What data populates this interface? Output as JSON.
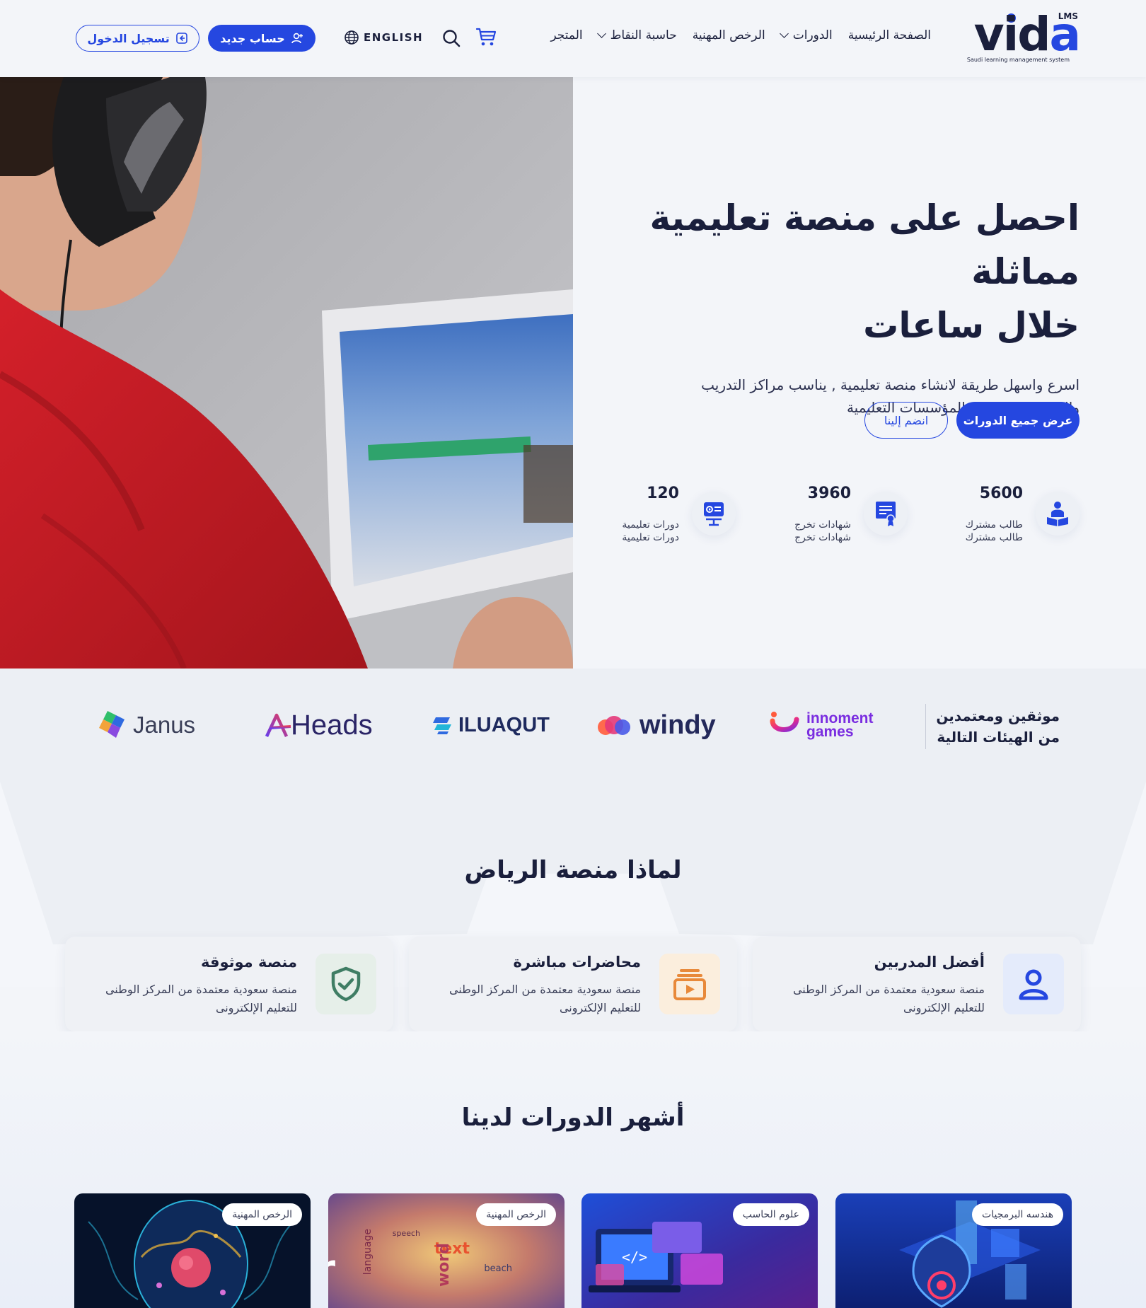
{
  "brand": {
    "name": "vida",
    "badge": "LMS",
    "tagline": "Saudi learning management system",
    "accent": "#2547e0"
  },
  "nav": {
    "items": [
      {
        "label": "الصفحة الرئيسية",
        "has_dropdown": false
      },
      {
        "label": "الدورات",
        "has_dropdown": true
      },
      {
        "label": "الرخص المهنية",
        "has_dropdown": false
      },
      {
        "label": "حاسبة النقاط",
        "has_dropdown": true
      },
      {
        "label": "المتجر",
        "has_dropdown": false
      }
    ],
    "language_label": "ENGLISH",
    "register_label": "حساب جديد",
    "login_label": "تسجيل الدخول"
  },
  "hero": {
    "title_line1": "احصل على منصة تعليمية مماثلة",
    "title_line2": "خلال ساعات",
    "subtitle_line1": "اسرع واسهل طريقة لانشاء منصة تعليمية , يناسب مراكز التدريب",
    "subtitle_line2": "والمعلمين ومختلف المؤسسات التعليمية",
    "primary_button": "عرض جميع الدورات",
    "secondary_button": "انضم إلينا",
    "stats": [
      {
        "value": "5600",
        "label_line1": "طالب مشترك",
        "label_line2": "طالب مشترك",
        "icon": "student-reading-icon"
      },
      {
        "value": "3960",
        "label_line1": "شهادات تخرج",
        "label_line2": "شهادات تخرج",
        "icon": "certificate-icon"
      },
      {
        "value": "120",
        "label_line1": "دورات تعليمية",
        "label_line2": "دورات تعليمية",
        "icon": "presentation-icon"
      }
    ]
  },
  "partners": {
    "title_line1": "موثقين ومعتمدين",
    "title_line2": "من الهيئات التالية",
    "logos": [
      {
        "name": "innoment games",
        "line1": "innoment",
        "line2": "games"
      },
      {
        "name": "windy",
        "text": "windy"
      },
      {
        "name": "ILUAQUT",
        "text": "ILUAQUT"
      },
      {
        "name": "Heads",
        "text": "Heads"
      },
      {
        "name": "Janus",
        "text": "Janus"
      }
    ]
  },
  "why": {
    "title": "لماذا منصة الرياض",
    "features": [
      {
        "title": "أفضل المدربين",
        "desc": "منصة سعودية معتمدة من المركز الوطنى للتعليم الإلكترونى",
        "icon": "user-icon",
        "icon_bg": "#e4ebfb",
        "icon_color": "#2547e0"
      },
      {
        "title": "محاضرات مباشرة",
        "desc": "منصة سعودية معتمدة من المركز الوطنى للتعليم الإلكترونى",
        "icon": "video-playlist-icon",
        "icon_bg": "#fbeedd",
        "icon_color": "#e8893a"
      },
      {
        "title": "منصة موثوقة",
        "desc": "منصة سعودية معتمدة من المركز الوطنى للتعليم الإلكترونى",
        "icon": "shield-check-icon",
        "icon_bg": "#e6efe9",
        "icon_color": "#3f7d64"
      }
    ]
  },
  "courses": {
    "title": "أشهر الدورات لدينا",
    "items": [
      {
        "tag": "هندسه البرمجيات",
        "image": "cyber-security-illustration"
      },
      {
        "tag": "علوم الحاسب",
        "image": "laptop-code-illustration"
      },
      {
        "tag": "الرخص المهنية",
        "image": "grammar-word-cloud"
      },
      {
        "tag": "الرخص المهنية",
        "image": "cell-biology-illustration"
      }
    ]
  }
}
